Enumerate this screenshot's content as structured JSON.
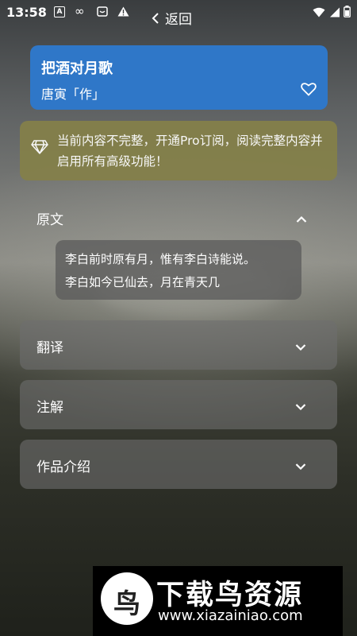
{
  "status_bar": {
    "time": "13:58",
    "icons": [
      "a-box-icon",
      "infinity-icon",
      "message-box-icon",
      "warning-icon",
      "wifi-icon",
      "signal-icon",
      "battery-icon"
    ]
  },
  "nav": {
    "back_label": "返回"
  },
  "poem": {
    "title": "把酒对月歌",
    "author": "唐寅「作」"
  },
  "pro_banner": {
    "text": "当前内容不完整，开通Pro订阅，阅读完整内容并启用所有高级功能！"
  },
  "original": {
    "label": "原文",
    "lines": [
      "李白前时原有月，惟有李白诗能说。",
      "李白如今已仙去，月在青天几"
    ]
  },
  "sections": [
    {
      "label": "翻译"
    },
    {
      "label": "注解"
    },
    {
      "label": "作品介绍"
    }
  ],
  "watermark": {
    "brand": "下载鸟资源",
    "url": "www.xiazainiao.com",
    "logo_char": "鸟"
  }
}
